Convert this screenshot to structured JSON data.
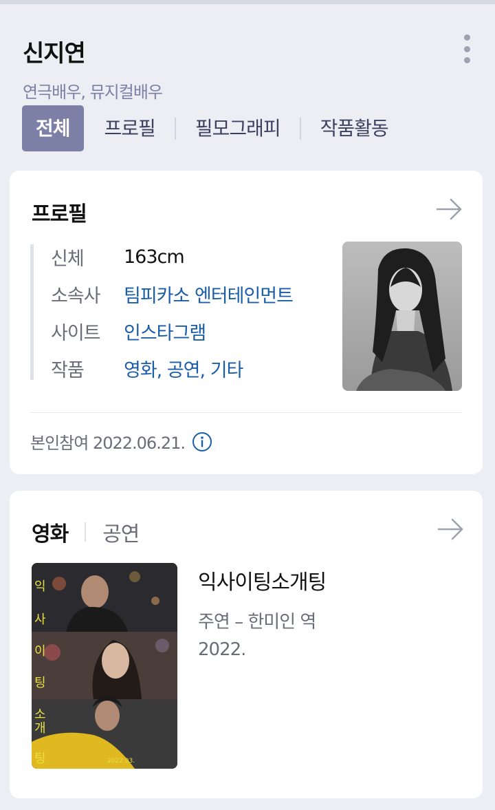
{
  "profile": {
    "name": "신지연",
    "occupation": "연극배우, 뮤지컬배우"
  },
  "tabs": [
    {
      "label": "전체",
      "active": true
    },
    {
      "label": "프로필",
      "active": false
    },
    {
      "label": "필모그래피",
      "active": false
    },
    {
      "label": "작품활동",
      "active": false
    }
  ],
  "profile_card": {
    "title": "프로필",
    "rows": [
      {
        "key": "신체",
        "value": "163cm",
        "link": false
      },
      {
        "key": "소속사",
        "value": "팀피카소 엔터테인먼트",
        "link": true
      },
      {
        "key": "사이트",
        "value": "인스타그램",
        "link": true
      },
      {
        "key": "작품",
        "value": "영화, 공연, 기타",
        "link": true
      }
    ],
    "footnote": "본인참여 2022.06.21."
  },
  "works_card": {
    "tabs": [
      {
        "label": "영화",
        "active": true
      },
      {
        "label": "공연",
        "active": false
      }
    ],
    "movie": {
      "title": "익사이팅소개팅",
      "role": "주연 – 한미인 역",
      "year": "2022."
    }
  },
  "icons": {
    "more": "more-vertical-icon",
    "arrow": "arrow-right-icon",
    "info": "info-circle-icon"
  },
  "colors": {
    "accent": "#7c7fa6",
    "link": "#1a5da8",
    "subtitle": "#7c80a6"
  }
}
